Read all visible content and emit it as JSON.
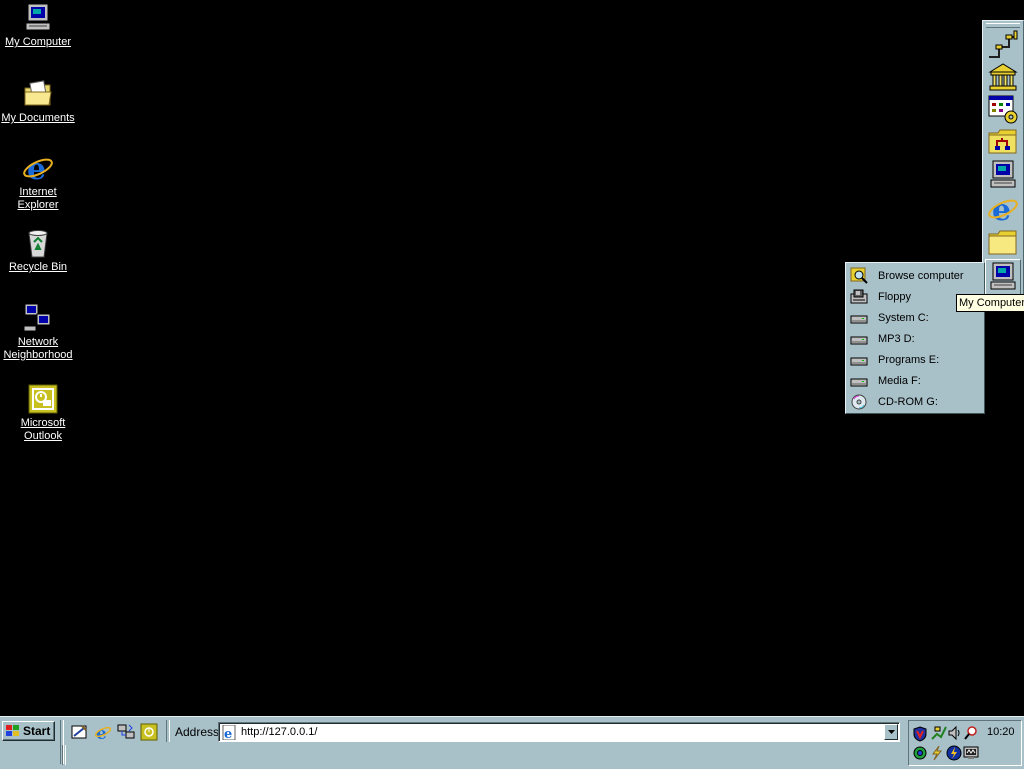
{
  "desktop": {
    "icons": [
      {
        "name": "my-computer",
        "icon": "computer-icon",
        "label": "My Computer"
      },
      {
        "name": "my-documents",
        "icon": "folder-icon",
        "label": "My Documents"
      },
      {
        "name": "internet-explorer",
        "icon": "ie-icon",
        "label": "Internet Explorer"
      },
      {
        "name": "recycle-bin",
        "icon": "recycle-bin-icon",
        "label": "Recycle Bin"
      },
      {
        "name": "network-neighborhood",
        "icon": "network-icon",
        "label": "Network Neighborhood"
      },
      {
        "name": "microsoft-outlook",
        "icon": "outlook-icon",
        "label": "Microsoft Outlook"
      }
    ]
  },
  "sidebar": {
    "buttons": [
      {
        "icon": "network-connections-icon"
      },
      {
        "icon": "bank-icon"
      },
      {
        "icon": "control-panel-icon"
      },
      {
        "icon": "network-folder-icon"
      },
      {
        "icon": "computer-icon"
      },
      {
        "icon": "ie-icon"
      },
      {
        "icon": "folder-icon"
      },
      {
        "icon": "my-computer-icon"
      }
    ]
  },
  "menu": {
    "items": [
      {
        "icon": "browse-icon",
        "label": "Browse computer"
      },
      {
        "icon": "floppy-icon",
        "label": "Floppy"
      },
      {
        "icon": "drive-icon",
        "label": "System C:"
      },
      {
        "icon": "drive-icon",
        "label": "MP3 D:"
      },
      {
        "icon": "drive-icon",
        "label": "Programs E:"
      },
      {
        "icon": "drive-icon",
        "label": "Media F:"
      },
      {
        "icon": "cdrom-icon",
        "label": "CD-ROM G:"
      }
    ]
  },
  "tooltip": {
    "text": "My Computer"
  },
  "taskbar": {
    "start_label": "Start",
    "address_label": "Address",
    "address_value": "http://127.0.0.1/",
    "clock": "10:20"
  },
  "colors": {
    "desktop": "#000000",
    "chrome": "#a8c0c8",
    "tooltip": "#ffffe1"
  }
}
